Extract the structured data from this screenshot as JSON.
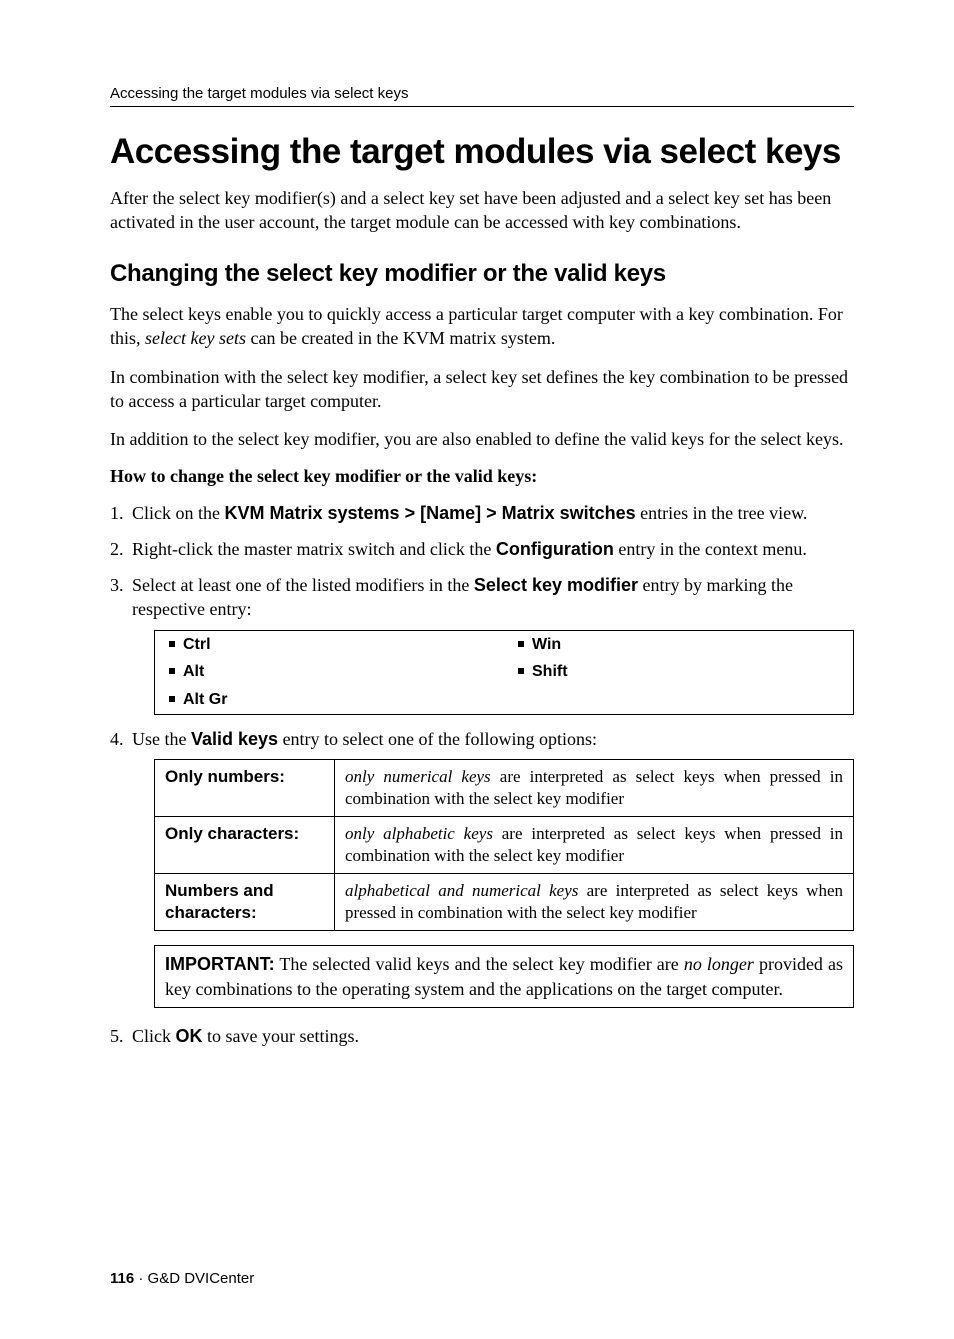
{
  "running_head": "Accessing the target modules via select keys",
  "h1": "Accessing the target modules via select keys",
  "intro": "After the select key modifier(s) and a select key set have been adjusted and a select key set has been activated in the user account, the target module can be accessed with key combinations.",
  "h2": "Changing the select key modifier or the valid keys",
  "p1": "The select keys enable you to quickly access a particular target computer with a key combination. For this, ",
  "p1_em": "select key sets",
  "p1_tail": " can be created in the KVM matrix system.",
  "p2": "In combination with the select key modifier, a select key set defines the key combination to be pressed to access a particular target computer.",
  "p3": "In addition to the select key modifier, you are also enabled to define the valid keys for the select keys.",
  "howto": "How to change the select key modifier or the valid keys:",
  "steps": {
    "s1_a": "Click on the ",
    "s1_b": "KVM Matrix systems > [Name] > Matrix switches",
    "s1_c": " entries in the tree view.",
    "s2_a": "Right-click the master matrix switch and click the ",
    "s2_b": "Configuration",
    "s2_c": " entry in the context menu.",
    "s3_a": "Select at least one of the listed modifiers in the ",
    "s3_b": "Select key modifier",
    "s3_c": " entry by marking the respective entry:",
    "s4_a": "Use the ",
    "s4_b": "Valid keys",
    "s4_c": " entry to select one of the following options:",
    "s5_a": "Click ",
    "s5_b": "OK",
    "s5_c": " to save your settings."
  },
  "modifiers": {
    "r1c1": "Ctrl",
    "r1c2": "Win",
    "r2c1": "Alt",
    "r2c2": "Shift",
    "r3c1": "Alt Gr"
  },
  "options": {
    "row1": {
      "label": "Only numbers:",
      "em": "only numerical keys",
      "rest": " are interpreted as select keys when pressed in combination with the select key modifier"
    },
    "row2": {
      "label": "Only characters:",
      "em": "only alphabetic keys",
      "rest": " are interpreted as select keys when pressed in combination with the select key modifier"
    },
    "row3": {
      "label": "Numbers and characters:",
      "em": "alphabetical and numerical keys",
      "rest": " are interpreted as select keys when pressed in combination with the select key modifier"
    }
  },
  "note": {
    "label": "IMPORTANT:",
    "a": " The selected valid keys and the select key modifier are ",
    "em": "no longer",
    "b": " provided as key combinations to the operating system and the applications on the target computer."
  },
  "footer": {
    "page": "116",
    "sep": " · ",
    "product": "G&D DVICenter"
  }
}
